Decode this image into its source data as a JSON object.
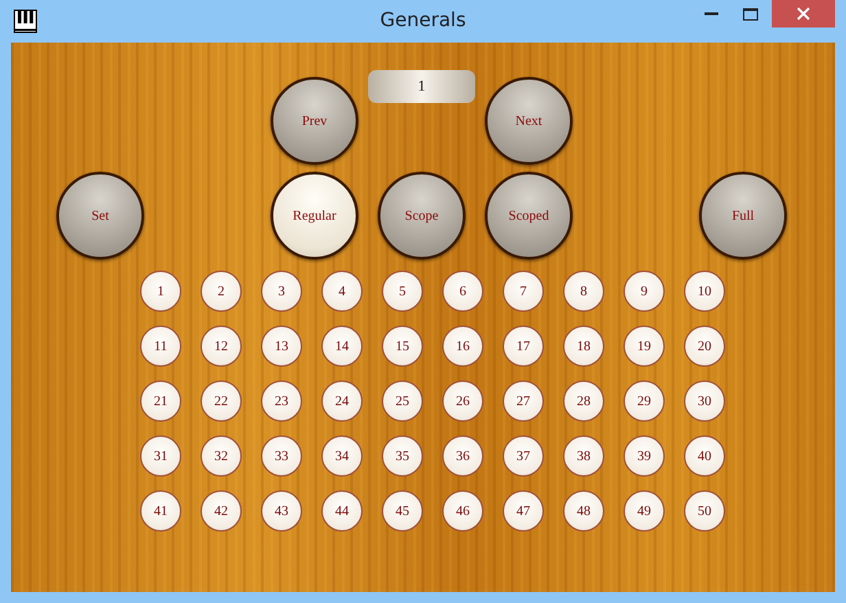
{
  "window": {
    "title": "Generals"
  },
  "nav": {
    "prev": "Prev",
    "value": "1",
    "next": "Next"
  },
  "modes": [
    {
      "label": "Set",
      "selected": false
    },
    {
      "label": "Regular",
      "selected": true
    },
    {
      "label": "Scope",
      "selected": false
    },
    {
      "label": "Scoped",
      "selected": false
    },
    {
      "label": "Full",
      "selected": false
    }
  ],
  "generals": [
    "1",
    "2",
    "3",
    "4",
    "5",
    "6",
    "7",
    "8",
    "9",
    "10",
    "11",
    "12",
    "13",
    "14",
    "15",
    "16",
    "17",
    "18",
    "19",
    "20",
    "21",
    "22",
    "23",
    "24",
    "25",
    "26",
    "27",
    "28",
    "29",
    "30",
    "31",
    "32",
    "33",
    "34",
    "35",
    "36",
    "37",
    "38",
    "39",
    "40",
    "41",
    "42",
    "43",
    "44",
    "45",
    "46",
    "47",
    "48",
    "49",
    "50"
  ]
}
